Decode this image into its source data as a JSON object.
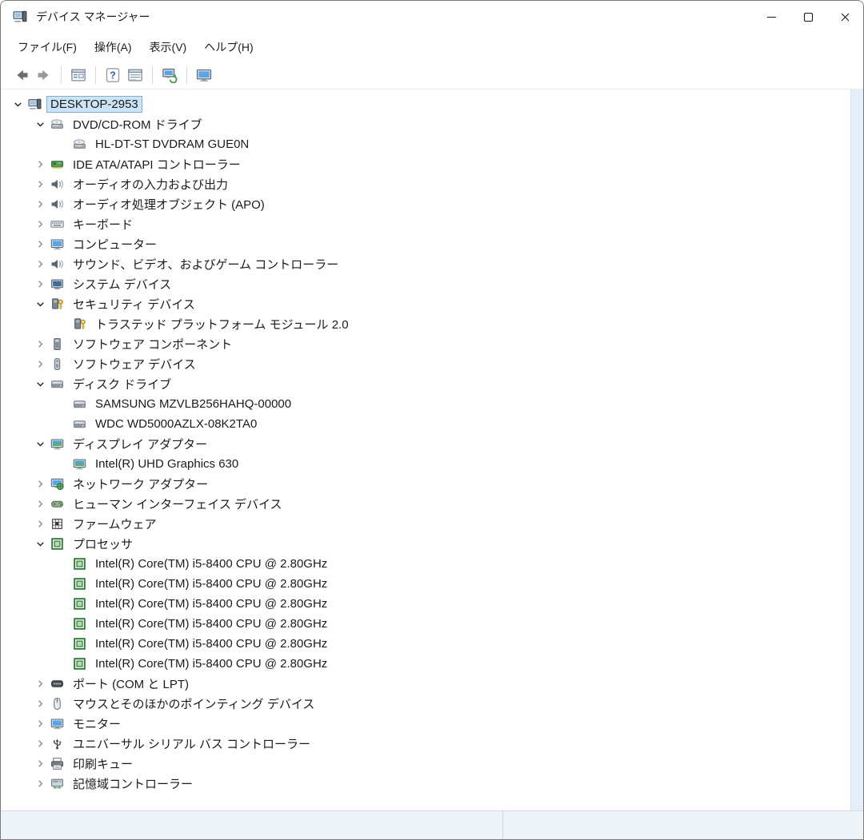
{
  "window": {
    "title": "デバイス マネージャー"
  },
  "menu": {
    "items": [
      {
        "name": "menu-file",
        "label": "ファイル(F)"
      },
      {
        "name": "menu-action",
        "label": "操作(A)"
      },
      {
        "name": "menu-view",
        "label": "表示(V)"
      },
      {
        "name": "menu-help",
        "label": "ヘルプ(H)"
      }
    ]
  },
  "toolbar": {
    "buttons": [
      {
        "name": "back-button",
        "icon": "arrow-left"
      },
      {
        "name": "forward-button",
        "icon": "arrow-right"
      },
      {
        "sep": true
      },
      {
        "name": "show-console-tree-button",
        "icon": "console"
      },
      {
        "sep": true
      },
      {
        "name": "help-button",
        "icon": "help"
      },
      {
        "name": "properties-button",
        "icon": "window-list"
      },
      {
        "sep": true
      },
      {
        "name": "scan-hardware-changes-button",
        "icon": "scan"
      },
      {
        "sep": true
      },
      {
        "name": "remote-computer-button",
        "icon": "monitor"
      }
    ]
  },
  "tree": {
    "items": [
      {
        "label": "DESKTOP-2953",
        "level": 0,
        "state": "expanded",
        "icon": "computer",
        "selected": true
      },
      {
        "label": "DVD/CD-ROM ドライブ",
        "level": 1,
        "state": "expanded",
        "icon": "dvd"
      },
      {
        "label": "HL-DT-ST DVDRAM GUE0N",
        "level": 2,
        "state": "leaf",
        "icon": "dvd"
      },
      {
        "label": "IDE ATA/ATAPI コントローラー",
        "level": 1,
        "state": "collapsed",
        "icon": "ide"
      },
      {
        "label": "オーディオの入力および出力",
        "level": 1,
        "state": "collapsed",
        "icon": "audio"
      },
      {
        "label": "オーディオ処理オブジェクト (APO)",
        "level": 1,
        "state": "collapsed",
        "icon": "audio"
      },
      {
        "label": "キーボード",
        "level": 1,
        "state": "collapsed",
        "icon": "keyboard"
      },
      {
        "label": "コンピューター",
        "level": 1,
        "state": "collapsed",
        "icon": "monitor"
      },
      {
        "label": "サウンド、ビデオ、およびゲーム コントローラー",
        "level": 1,
        "state": "collapsed",
        "icon": "audio"
      },
      {
        "label": "システム デバイス",
        "level": 1,
        "state": "collapsed",
        "icon": "system"
      },
      {
        "label": "セキュリティ デバイス",
        "level": 1,
        "state": "expanded",
        "icon": "security"
      },
      {
        "label": "トラステッド プラットフォーム モジュール 2.0",
        "level": 2,
        "state": "leaf",
        "icon": "security"
      },
      {
        "label": "ソフトウェア コンポーネント",
        "level": 1,
        "state": "collapsed",
        "icon": "software-component"
      },
      {
        "label": "ソフトウェア デバイス",
        "level": 1,
        "state": "collapsed",
        "icon": "software-device"
      },
      {
        "label": "ディスク ドライブ",
        "level": 1,
        "state": "expanded",
        "icon": "disk"
      },
      {
        "label": "SAMSUNG MZVLB256HAHQ-00000",
        "level": 2,
        "state": "leaf",
        "icon": "disk"
      },
      {
        "label": "WDC WD5000AZLX-08K2TA0",
        "level": 2,
        "state": "leaf",
        "icon": "disk"
      },
      {
        "label": "ディスプレイ アダプター",
        "level": 1,
        "state": "expanded",
        "icon": "display"
      },
      {
        "label": "Intel(R) UHD Graphics 630",
        "level": 2,
        "state": "leaf",
        "icon": "display"
      },
      {
        "label": "ネットワーク アダプター",
        "level": 1,
        "state": "collapsed",
        "icon": "network"
      },
      {
        "label": "ヒューマン インターフェイス デバイス",
        "level": 1,
        "state": "collapsed",
        "icon": "hid"
      },
      {
        "label": "ファームウェア",
        "level": 1,
        "state": "collapsed",
        "icon": "firmware"
      },
      {
        "label": "プロセッサ",
        "level": 1,
        "state": "expanded",
        "icon": "processor"
      },
      {
        "label": "Intel(R) Core(TM) i5-8400 CPU @ 2.80GHz",
        "level": 2,
        "state": "leaf",
        "icon": "processor"
      },
      {
        "label": "Intel(R) Core(TM) i5-8400 CPU @ 2.80GHz",
        "level": 2,
        "state": "leaf",
        "icon": "processor"
      },
      {
        "label": "Intel(R) Core(TM) i5-8400 CPU @ 2.80GHz",
        "level": 2,
        "state": "leaf",
        "icon": "processor"
      },
      {
        "label": "Intel(R) Core(TM) i5-8400 CPU @ 2.80GHz",
        "level": 2,
        "state": "leaf",
        "icon": "processor"
      },
      {
        "label": "Intel(R) Core(TM) i5-8400 CPU @ 2.80GHz",
        "level": 2,
        "state": "leaf",
        "icon": "processor"
      },
      {
        "label": "Intel(R) Core(TM) i5-8400 CPU @ 2.80GHz",
        "level": 2,
        "state": "leaf",
        "icon": "processor"
      },
      {
        "label": "ポート (COM と LPT)",
        "level": 1,
        "state": "collapsed",
        "icon": "ports"
      },
      {
        "label": "マウスとそのほかのポインティング デバイス",
        "level": 1,
        "state": "collapsed",
        "icon": "mouse"
      },
      {
        "label": "モニター",
        "level": 1,
        "state": "collapsed",
        "icon": "monitor"
      },
      {
        "label": "ユニバーサル シリアル バス コントローラー",
        "level": 1,
        "state": "collapsed",
        "icon": "usb"
      },
      {
        "label": "印刷キュー",
        "level": 1,
        "state": "collapsed",
        "icon": "printer"
      },
      {
        "label": "記憶域コントローラー",
        "level": 1,
        "state": "collapsed",
        "icon": "storage"
      }
    ]
  },
  "statusbar": {
    "left": "",
    "right": ""
  },
  "colors": {
    "selection_bg": "#cbe4f6",
    "selection_border": "#7ab0dc",
    "scrollbar_track": "#e4edf9",
    "statusbar_bg": "#eef3fa"
  }
}
